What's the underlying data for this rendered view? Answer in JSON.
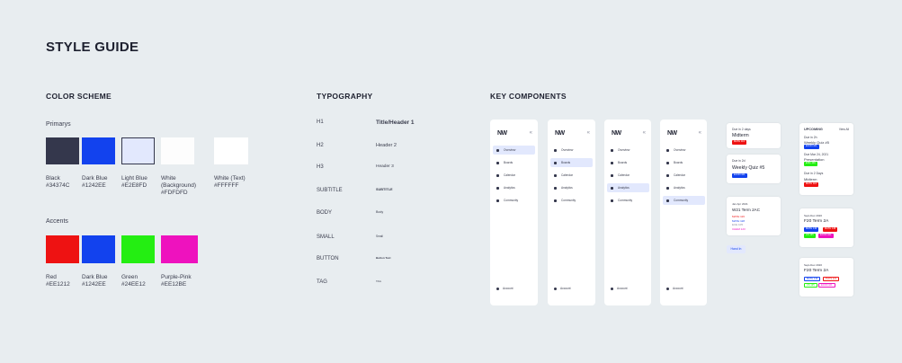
{
  "title": "STYLE GUIDE",
  "color_scheme": {
    "heading": "COLOR SCHEME",
    "primary_label": "Primarys",
    "primary": [
      {
        "name": "Black",
        "hex": "#34374C",
        "color": "#34374C"
      },
      {
        "name": "Dark Blue",
        "hex": "#1242EE",
        "color": "#1242EE"
      },
      {
        "name": "Light Blue",
        "hex": "#E2E8FD",
        "color": "#E2E8FD"
      },
      {
        "name": "White (Background)",
        "hex": "#FDFDFD",
        "color": "#FDFDFD"
      },
      {
        "name": "White (Text)",
        "hex": "#FFFFFF",
        "color": "#FFFFFF"
      }
    ],
    "accents_label": "Accents",
    "accents": [
      {
        "name": "Red",
        "hex": "#EE1212",
        "color": "#EE1212"
      },
      {
        "name": "Dark Blue",
        "hex": "#1242EE",
        "color": "#1242EE"
      },
      {
        "name": "Green",
        "hex": "#24EE12",
        "color": "#24EE12"
      },
      {
        "name": "Purple-Pink",
        "hex": "#EE12BE",
        "color": "#EE12BE"
      }
    ]
  },
  "typography": {
    "heading": "TYPOGRAPHY",
    "rows": [
      {
        "label": "H1",
        "sample": "Title/Header 1"
      },
      {
        "label": "H2",
        "sample": "Header 2"
      },
      {
        "label": "H3",
        "sample": "Header 3"
      },
      {
        "label": "SUBTITLE",
        "sample": "SUBTITLE"
      },
      {
        "label": "BODY",
        "sample": "Body"
      },
      {
        "label": "SMALL",
        "sample": "Small"
      },
      {
        "label": "BUTTON",
        "sample": "Button Text"
      },
      {
        "label": "TAG",
        "sample": "TAG"
      }
    ]
  },
  "components": {
    "heading": "KEY COMPONENTS",
    "nav": {
      "logo": "NW",
      "collapse": "«",
      "items": [
        "Overview",
        "Boards",
        "Calendar",
        "Analytics",
        "Community"
      ],
      "account": "Account",
      "active_index": [
        0,
        1,
        3,
        4
      ]
    },
    "deadline_cards": [
      {
        "due": "Due in 2 days",
        "title": "Midterm",
        "tag": "MATH 116",
        "tag_color": "#EE1212"
      },
      {
        "due": "Due in 2d",
        "title": "Weekly Quiz #5",
        "tag": "ECON 101",
        "tag_color": "#1242EE"
      }
    ],
    "event_card": {
      "date": "Jan Apr 2021",
      "title": "W21 Term 2AC",
      "items": [
        "MATH 116",
        "MATH 118",
        "ECE 105",
        "CHEM 123"
      ]
    },
    "button": {
      "label": "Hand In"
    },
    "upcoming": {
      "title": "UPCOMING",
      "view_all": "View All",
      "entries": [
        {
          "due": "Due in 2h",
          "title": "Weekly Quiz #5",
          "tag": "ECON 101",
          "tag_color": "#1242EE"
        },
        {
          "due": "Due Mar 24, 2021",
          "title": "Presentation",
          "tag": "ENG 100",
          "tag_color": "#24EE12"
        },
        {
          "due": "Due in 2 Days",
          "title": "Midterm",
          "tag": "MATH 116",
          "tag_color": "#EE1212"
        }
      ]
    },
    "term_cards": [
      {
        "date": "Sept-Dec 2020",
        "title": "F20 Term 2A",
        "tags": [
          "MATH 136",
          "MATH 138",
          "CS 135",
          "ECON 101"
        ],
        "outlined": false
      },
      {
        "date": "Sept-Dec 2020",
        "title": "F20 Term 2A",
        "tags": [
          "MATH 136",
          "PHYS 121",
          "CS 135",
          "ECON 101"
        ],
        "outlined": true
      }
    ]
  }
}
